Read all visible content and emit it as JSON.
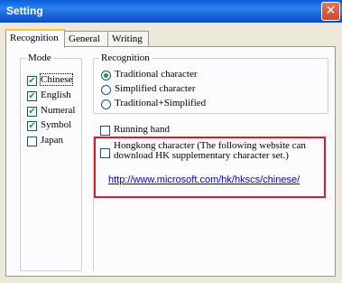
{
  "window": {
    "title": "Setting",
    "close_glyph": "✕"
  },
  "tabs": [
    {
      "label": "Recognition",
      "active": true
    },
    {
      "label": "General",
      "active": false
    },
    {
      "label": "Writing",
      "active": false
    }
  ],
  "mode": {
    "legend": "Mode",
    "items": [
      {
        "label": "Chinese",
        "checked": true
      },
      {
        "label": "English",
        "checked": true
      },
      {
        "label": "Numeral",
        "checked": true
      },
      {
        "label": "Symbol",
        "checked": true
      },
      {
        "label": "Japan",
        "checked": false
      }
    ]
  },
  "recognition": {
    "legend": "Recognition",
    "options": [
      {
        "label": "Traditional character",
        "selected": true
      },
      {
        "label": "Simplified character",
        "selected": false
      },
      {
        "label": "Traditional+Simplified",
        "selected": false
      }
    ]
  },
  "running_hand": {
    "label": "Running hand",
    "checked": false
  },
  "hongkong": {
    "label_line1": "Hongkong character (The following website can",
    "label_line2": "download HK supplementary character set.)",
    "checked": false,
    "link": "http://www.microsoft.com/hk/hkscs/chinese/"
  },
  "colors": {
    "highlight": "#e3162a",
    "link": "#0b00c8",
    "titlebar": "#0a5fd8"
  }
}
